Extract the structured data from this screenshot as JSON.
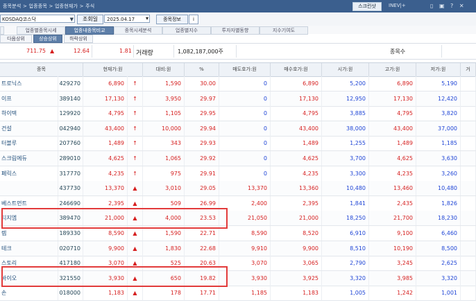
{
  "header": {
    "breadcrumb": "종목분석 > 업종종목 > 업종현재가 > 주식",
    "right_button": "스크린샷",
    "right_text": "INEV|+",
    "title_icons": "▯ ▣ ? ✕"
  },
  "toolbar": {
    "market_select": "KOSDAQ코스닥",
    "lookup_label": "조회일",
    "date_value": "2025.04.17",
    "info_button": "종목정보",
    "icon_button": "i"
  },
  "tabs_top": [
    "",
    "업종별종목시세",
    "업종내종목비교",
    "종목시세분석",
    "업종별지수",
    "투자자별동향",
    "지수기여도"
  ],
  "tabs_second": [
    "다음상위",
    "상승상위",
    "하락상위"
  ],
  "summary": {
    "index_value": "711.75",
    "index_dir": "▲",
    "change": "12.64",
    "change_pct": "1.81",
    "volume_label": "거래량",
    "volume_value": "1,082,187,000주",
    "count_label": "종목수"
  },
  "grid": {
    "headers": [
      "종목",
      "",
      "현재가:원",
      "",
      "대비:원",
      "%",
      "매도호가:원",
      "매수호가:원",
      "시가:원",
      "고가:원",
      "저가:원",
      "거"
    ],
    "rows": [
      {
        "name": "트로닉스",
        "code": "429270",
        "cur": "6,890",
        "dir": "↑",
        "chg": "1,590",
        "pct": "30.00",
        "ask": "0",
        "bid": "6,890",
        "open": "5,200",
        "high": "6,890",
        "low": "5,190",
        "style": "up"
      },
      {
        "name": "이프",
        "code": "389140",
        "cur": "17,130",
        "dir": "↑",
        "chg": "3,950",
        "pct": "29.97",
        "ask": "0",
        "bid": "17,130",
        "open": "12,950",
        "high": "17,130",
        "low": "12,420",
        "style": "up"
      },
      {
        "name": "하이텍",
        "code": "129920",
        "cur": "4,795",
        "dir": "↑",
        "chg": "1,105",
        "pct": "29.95",
        "ask": "0",
        "bid": "4,795",
        "open": "3,885",
        "high": "4,795",
        "low": "3,820",
        "style": "up"
      },
      {
        "name": "건설",
        "code": "042940",
        "cur": "43,400",
        "dir": "↑",
        "chg": "10,000",
        "pct": "29.94",
        "ask": "0",
        "bid": "43,400",
        "open": "38,000",
        "high": "43,400",
        "low": "37,000",
        "style": "up"
      },
      {
        "name": "터블루",
        "code": "207760",
        "cur": "1,489",
        "dir": "↑",
        "chg": "343",
        "pct": "29.93",
        "ask": "0",
        "bid": "1,489",
        "open": "1,255",
        "high": "1,489",
        "low": "1,185",
        "style": "up"
      },
      {
        "name": "스크림에듀",
        "code": "289010",
        "cur": "4,625",
        "dir": "↑",
        "chg": "1,065",
        "pct": "29.92",
        "ask": "0",
        "bid": "4,625",
        "open": "3,700",
        "high": "4,625",
        "low": "3,630",
        "style": "up"
      },
      {
        "name": "페릭스",
        "code": "317770",
        "cur": "4,235",
        "dir": "↑",
        "chg": "975",
        "pct": "29.91",
        "ask": "0",
        "bid": "4,235",
        "open": "3,300",
        "high": "4,235",
        "low": "3,260",
        "style": "up"
      },
      {
        "name": "",
        "code": "437730",
        "cur": "13,370",
        "dir": "▲",
        "chg": "3,010",
        "pct": "29.05",
        "ask": "13,370",
        "bid": "13,360",
        "open": "10,480",
        "high": "13,460",
        "low": "10,480",
        "style": "up"
      },
      {
        "name": "베스트먼트",
        "code": "246690",
        "cur": "2,395",
        "dir": "▲",
        "chg": "509",
        "pct": "26.99",
        "ask": "2,400",
        "bid": "2,395",
        "open": "1,841",
        "high": "2,435",
        "low": "1,826",
        "style": "up"
      },
      {
        "name": "티지엠",
        "code": "389470",
        "cur": "21,000",
        "dir": "▲",
        "chg": "4,000",
        "pct": "23.53",
        "ask": "21,050",
        "bid": "21,000",
        "open": "18,250",
        "high": "21,700",
        "low": "18,230",
        "style": "up"
      },
      {
        "name": "렙",
        "code": "189330",
        "cur": "8,590",
        "dir": "▲",
        "chg": "1,590",
        "pct": "22.71",
        "ask": "8,590",
        "bid": "8,520",
        "open": "6,910",
        "high": "9,100",
        "low": "6,460",
        "style": "up"
      },
      {
        "name": "테크",
        "code": "020710",
        "cur": "9,900",
        "dir": "▲",
        "chg": "1,830",
        "pct": "22.68",
        "ask": "9,910",
        "bid": "9,900",
        "open": "8,510",
        "high": "10,190",
        "low": "8,500",
        "style": "up"
      },
      {
        "name": "스토리",
        "code": "417180",
        "cur": "3,070",
        "dir": "▲",
        "chg": "525",
        "pct": "20.63",
        "ask": "3,070",
        "bid": "3,065",
        "open": "2,790",
        "high": "3,245",
        "low": "2,625",
        "style": "up"
      },
      {
        "name": "바이오",
        "code": "321550",
        "cur": "3,930",
        "dir": "▲",
        "chg": "650",
        "pct": "19.82",
        "ask": "3,930",
        "bid": "3,925",
        "open": "3,320",
        "high": "3,985",
        "low": "3,320",
        "style": "up"
      },
      {
        "name": "손",
        "code": "018000",
        "cur": "1,183",
        "dir": "▲",
        "chg": "178",
        "pct": "17.71",
        "ask": "1,185",
        "bid": "1,183",
        "open": "1,005",
        "high": "1,242",
        "low": "1,001",
        "style": "up"
      }
    ]
  }
}
